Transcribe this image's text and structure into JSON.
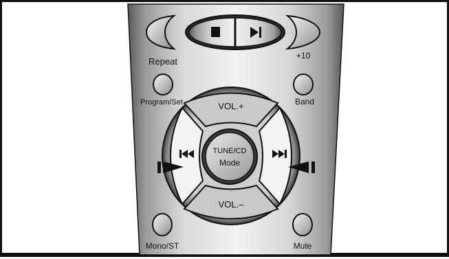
{
  "remote": {
    "buttons": {
      "stop_symbol": "■",
      "skip_symbol": "▶|"
    },
    "labels": {
      "repeat": "Repeat",
      "plus10": "+10",
      "program_set": "Program/Set",
      "band": "Band",
      "vol_plus": "VOL.+",
      "vol_minus": "VOL.–",
      "tune_cd": "TUNE/CD",
      "mode": "Mode",
      "mono_st": "Mono/ST",
      "mute": "Mute"
    },
    "icons": {
      "left_track": "prev-track-icon",
      "right_track": "next-track-icon",
      "left_play": "play-right-icon",
      "right_play": "play-left-icon"
    }
  }
}
